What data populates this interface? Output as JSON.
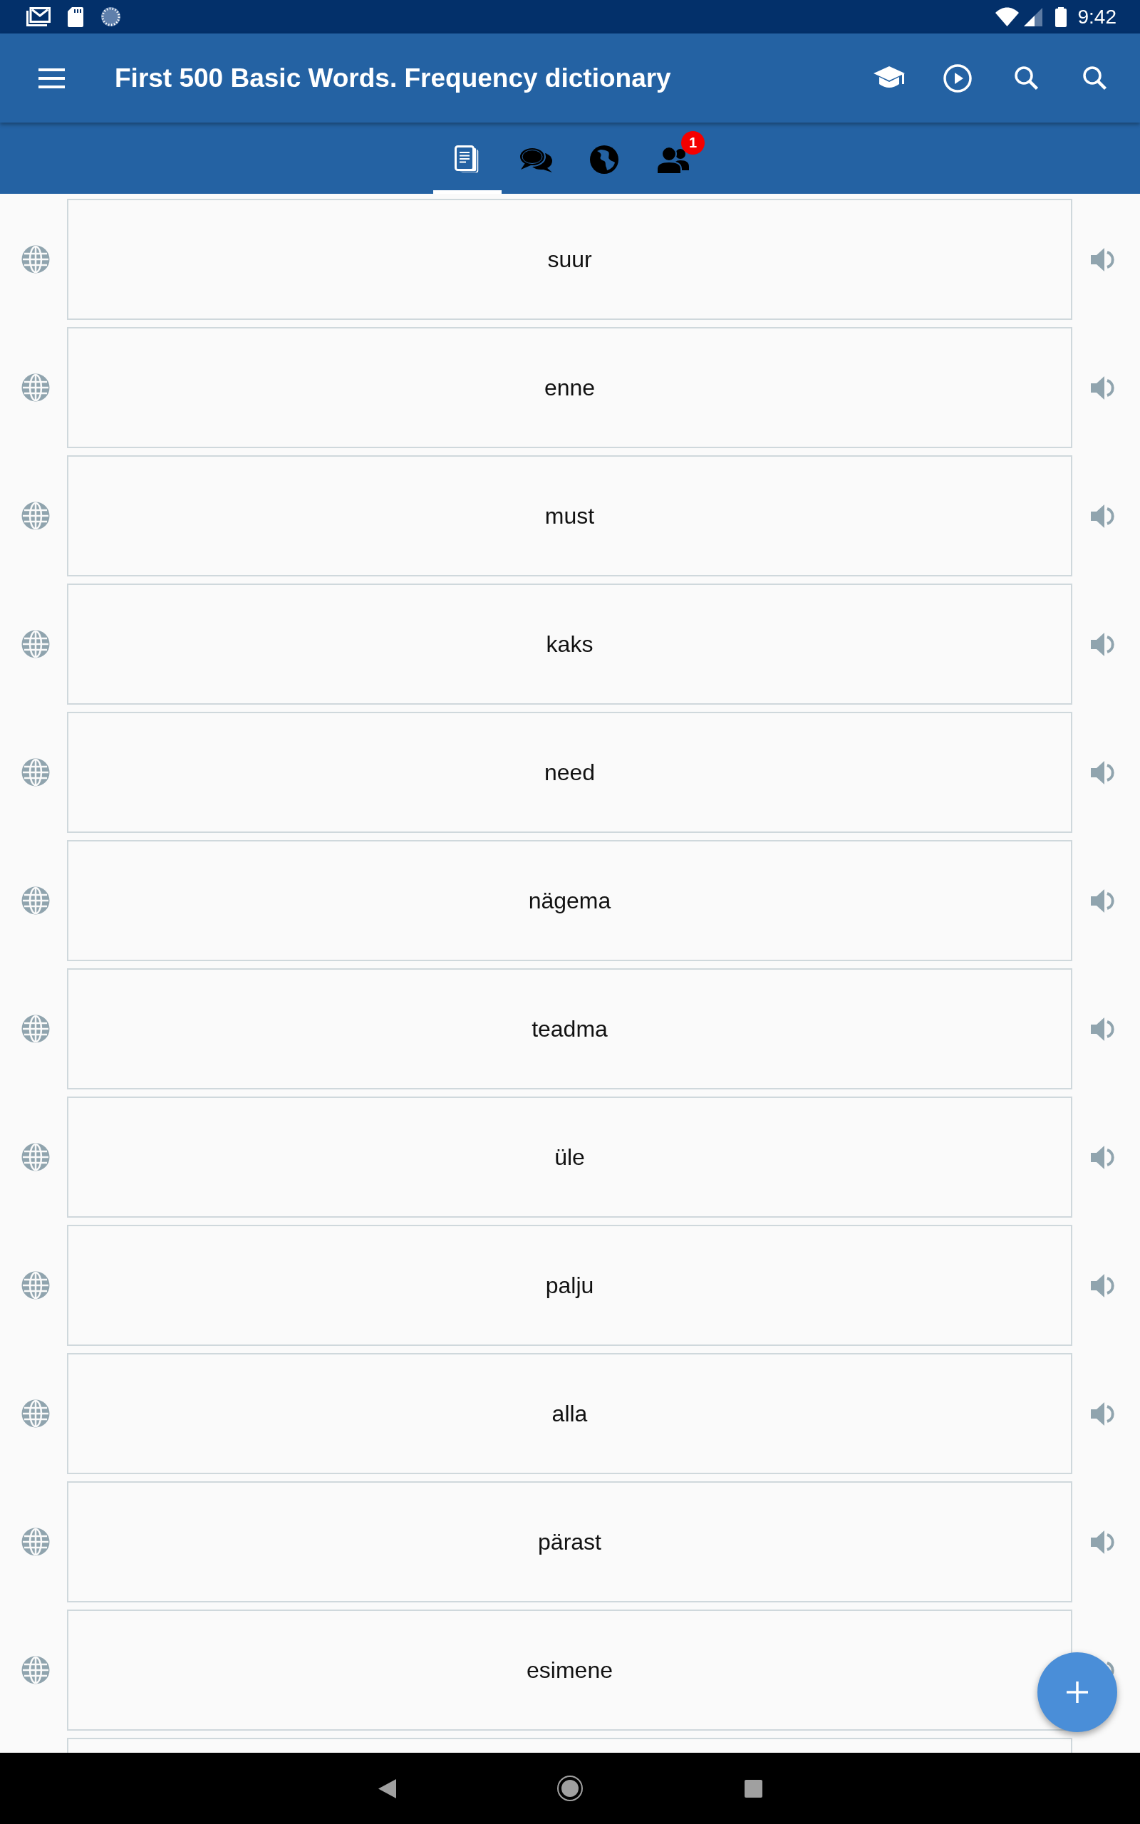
{
  "status_bar": {
    "time": "9:42"
  },
  "app_bar": {
    "title": "First 500 Basic Words. Frequency dictionary"
  },
  "tabs": [
    {
      "selected": true
    },
    {
      "selected": false
    },
    {
      "selected": false
    },
    {
      "selected": false,
      "badge": "1"
    }
  ],
  "words": [
    "suur",
    "enne",
    "must",
    "kaks",
    "need",
    "nägema",
    "teadma",
    "üle",
    "palju",
    "alla",
    "pärast",
    "esimene"
  ]
}
